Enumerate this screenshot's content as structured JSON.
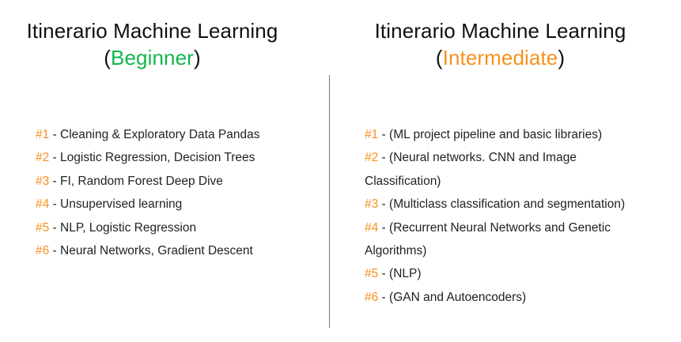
{
  "colors": {
    "beginner": "#13b54b",
    "intermediate": "#f7901e",
    "number": "#f7901e"
  },
  "beginner": {
    "title": "Itinerario Machine Learning",
    "paren_open": "(",
    "level": "Beginner",
    "paren_close": ")",
    "items": [
      {
        "num": "#1",
        "sep": " - ",
        "text": "Cleaning & Exploratory Data Pandas"
      },
      {
        "num": "#2",
        "sep": " - ",
        "text": "Logistic Regression, Decision Trees"
      },
      {
        "num": "#3",
        "sep": " - ",
        "text": "FI, Random Forest Deep Dive"
      },
      {
        "num": "#4",
        "sep": " - ",
        "text": "Unsupervised learning"
      },
      {
        "num": "#5",
        "sep": " - ",
        "text": "NLP, Logistic Regression"
      },
      {
        "num": "#6",
        "sep": " - ",
        "text": "Neural Networks, Gradient Descent"
      }
    ]
  },
  "intermediate": {
    "title": "Itinerario Machine Learning",
    "paren_open": "(",
    "level": "Intermediate",
    "paren_close": ")",
    "items": [
      {
        "num": "#1",
        "sep": " - ",
        "text": "(ML project pipeline and basic libraries)"
      },
      {
        "num": "#2",
        "sep": " - ",
        "text": "(Neural networks. CNN and Image Classification)"
      },
      {
        "num": "#3",
        "sep": " - ",
        "text": "(Multiclass classification and segmentation)"
      },
      {
        "num": "#4",
        "sep": " - ",
        "text": "(Recurrent Neural Networks and Genetic Algorithms)"
      },
      {
        "num": "#5",
        "sep": " - ",
        "text": "(NLP)"
      },
      {
        "num": "#6",
        "sep": " - ",
        "text": "(GAN and Autoencoders)"
      }
    ]
  }
}
